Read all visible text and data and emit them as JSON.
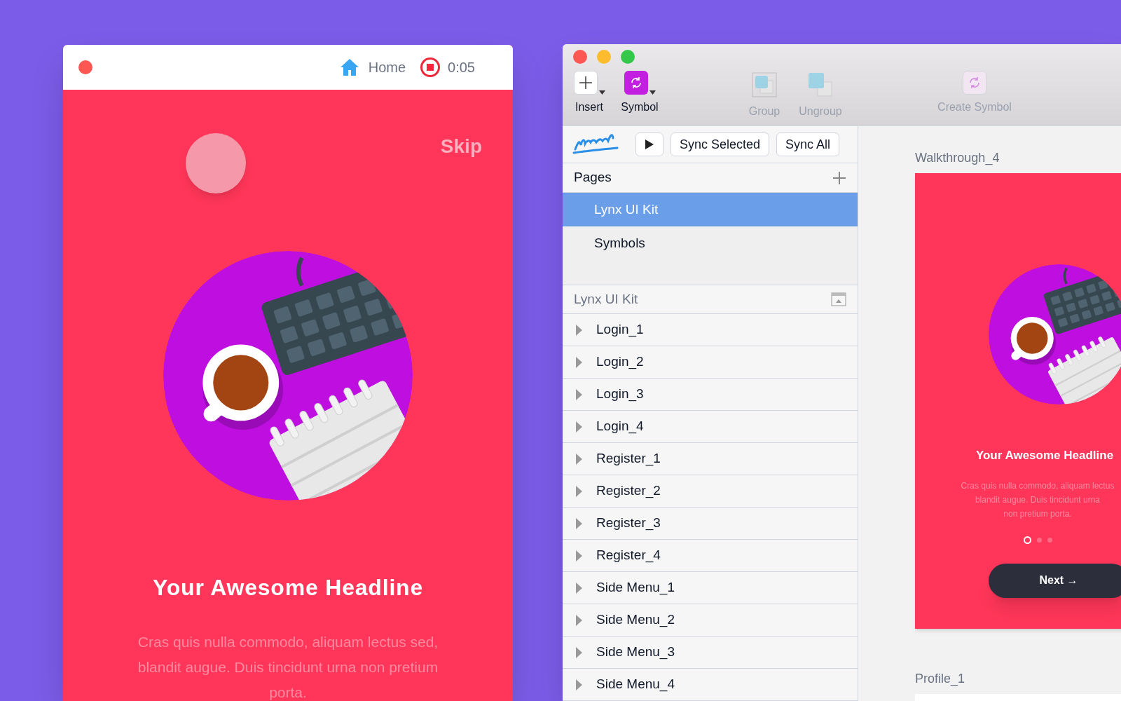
{
  "preview_window": {
    "home_label": "Home",
    "recording": true,
    "timer": "0:05",
    "skip": "Skip",
    "headline": "Your Awesome Headline",
    "body": "Cras quis nulla commodo, aliquam lectus sed, blandit augue. Duis tincidunt urna non pretium porta."
  },
  "sketch": {
    "toolbar": [
      {
        "label": "Insert",
        "kind": "insert",
        "disabled": false
      },
      {
        "label": "Symbol",
        "kind": "symbol",
        "disabled": false
      },
      {
        "label": "Group",
        "kind": "group",
        "disabled": true
      },
      {
        "label": "Ungroup",
        "kind": "ungroup",
        "disabled": true
      },
      {
        "label": "Create Symbol",
        "kind": "create_symbol",
        "disabled": true
      }
    ],
    "marvel": {
      "buttons": [
        "Sync Selected",
        "Sync All"
      ]
    },
    "pages": {
      "title": "Pages",
      "items": [
        {
          "label": "Lynx UI Kit",
          "selected": true
        },
        {
          "label": "Symbols",
          "selected": false
        }
      ]
    },
    "layers": {
      "title": "Lynx UI Kit",
      "items": [
        {
          "label": "Login_1",
          "expanded": false
        },
        {
          "label": "Login_2",
          "expanded": false
        },
        {
          "label": "Login_3",
          "expanded": false
        },
        {
          "label": "Login_4",
          "expanded": false
        },
        {
          "label": "Register_1",
          "expanded": false
        },
        {
          "label": "Register_2",
          "expanded": false
        },
        {
          "label": "Register_3",
          "expanded": false
        },
        {
          "label": "Register_4",
          "expanded": false
        },
        {
          "label": "Side Menu_1",
          "expanded": false
        },
        {
          "label": "Side Menu_2",
          "expanded": false
        },
        {
          "label": "Side Menu_3",
          "expanded": false
        },
        {
          "label": "Side Menu_4",
          "expanded": false
        }
      ]
    },
    "canvas": {
      "artboards": [
        {
          "name": "Walkthrough_4",
          "headline": "Your Awesome Headline",
          "body_lines": [
            "Cras quis nulla commodo, aliquam lectus",
            "blandit augue. Duis tincidunt urna",
            "non pretium porta."
          ],
          "dots": [
            {
              "selected": true
            },
            {
              "selected": false
            },
            {
              "selected": false
            }
          ],
          "button": "Next →"
        },
        {
          "name": "Profile_1"
        }
      ]
    }
  }
}
